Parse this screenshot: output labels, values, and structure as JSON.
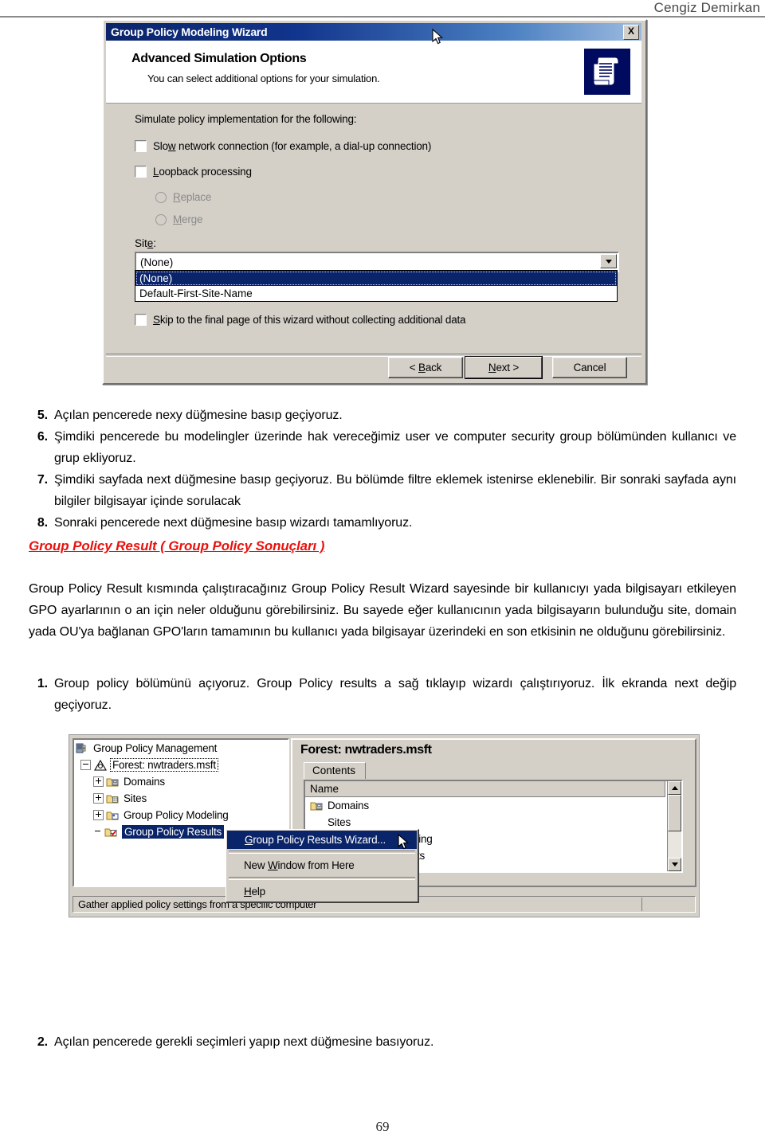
{
  "header": {
    "author": "Cengiz Demirkan"
  },
  "wizard_dialog": {
    "title": "Group Policy Modeling Wizard",
    "close_label": "X",
    "banner_title": "Advanced Simulation Options",
    "banner_subtitle": "You can select additional options for your simulation.",
    "banner_icon": "scroll-document-icon",
    "intro_label": "Simulate policy implementation for the following:",
    "checkbox_slow_network": {
      "label_prefix": "Slo",
      "label_accel": "w",
      "label_suffix": " network connection (for example, a dial-up connection)",
      "checked": false
    },
    "checkbox_loopback": {
      "label_accel": "L",
      "label_suffix": "oopback processing",
      "checked": false
    },
    "radio_replace": {
      "label_accel": "R",
      "label_suffix": "eplace",
      "selected": false,
      "enabled": false
    },
    "radio_merge": {
      "label_accel": "M",
      "label_suffix": "erge",
      "selected": false,
      "enabled": false
    },
    "site_label_prefix": "Sit",
    "site_label_accel": "e",
    "site_label_suffix": ":",
    "site_value": "(None)",
    "site_options": [
      "(None)",
      "Default-First-Site-Name"
    ],
    "site_selected_index": 0,
    "checkbox_skip": {
      "label_accel": "S",
      "label_suffix": "kip to the final page of this wizard without collecting additional data",
      "checked": false
    },
    "buttons": {
      "back_prefix": "< ",
      "back_accel": "B",
      "back_suffix": "ack",
      "next_accel": "N",
      "next_suffix": "ext >",
      "cancel": "Cancel"
    }
  },
  "steps_first": [
    {
      "num": "5.",
      "text": "Açılan pencerede nexy düğmesine basıp geçiyoruz."
    },
    {
      "num": "6.",
      "text": "Şimdiki pencerede bu modelingler üzerinde hak vereceğimiz user ve computer security group bölümünden kullanıcı ve grup ekliyoruz."
    },
    {
      "num": "7.",
      "text": "Şimdiki sayfada next düğmesine basıp geçiyoruz. Bu bölümde filtre eklemek istenirse eklenebilir. Bir sonraki sayfada aynı bilgiler  bilgisayar içinde sorulacak"
    },
    {
      "num": "8.",
      "text": "Sonraki pencerede next düğmesine basıp wizardı tamamlıyoruz."
    }
  ],
  "section": {
    "heading": "Group Policy Result  ( Group Policy Sonuçları )",
    "paragraph": "Group Policy Result kısmında çalıştıracağınız Group Policy Result Wizard sayesinde bir kullanıcıyı yada bilgisayarı etkileyen GPO ayarlarının o an için neler olduğunu görebilirsiniz. Bu sayede eğer kullanıcının yada bilgisayarın bulunduğu site, domain yada OU'ya bağlanan GPO'ların tamamının bu kullanıcı yada bilgisayar üzerindeki en son etkisinin ne olduğunu görebilirsiniz."
  },
  "steps_second": [
    {
      "num": "1.",
      "text": "Group policy bölümünü açıyoruz. Group Policy results a sağ tıklayıp wizardı çalıştırıyoruz. İlk ekranda next değip geçiyoruz."
    }
  ],
  "steps_third": [
    {
      "num": "2.",
      "text": "Açılan pencerede gerekli seçimleri yapıp next düğmesine basıyoruz."
    }
  ],
  "gpmc": {
    "tree": [
      {
        "label": "Group Policy Management",
        "icon": "console-root-icon",
        "expander": "none",
        "state": "normal",
        "indent": 2
      },
      {
        "label": "Forest: nwtraders.msft",
        "icon": "forest-icon",
        "expander": "minus",
        "state": "focused",
        "indent": 12
      },
      {
        "label": "Domains",
        "icon": "domains-folder-icon",
        "expander": "plus",
        "state": "normal",
        "indent": 28
      },
      {
        "label": "Sites",
        "icon": "sites-folder-icon",
        "expander": "plus",
        "state": "normal",
        "indent": 28
      },
      {
        "label": "Group Policy Modeling",
        "icon": "modeling-folder-icon",
        "expander": "plus",
        "state": "normal",
        "indent": 28
      },
      {
        "label": "Group Policy Results",
        "icon": "results-folder-icon",
        "expander": "none",
        "state": "selected",
        "indent": 28
      }
    ],
    "right_pane": {
      "forest_title": "Forest: nwtraders.msft",
      "tab_label": "Contents",
      "column_header": "Name",
      "rows": [
        {
          "label": "Domains",
          "icon": "domains-folder-icon"
        },
        {
          "label": "Sites",
          "icon": "sites-folder-icon"
        },
        {
          "label": "Group Policy Modeling",
          "icon": "modeling-folder-icon"
        },
        {
          "label": "Group Policy Results",
          "icon": "results-folder-icon"
        }
      ],
      "scroll_up": "scroll-up-arrow-icon",
      "scroll_down": "scroll-down-arrow-icon"
    },
    "context_menu": [
      {
        "accel": "G",
        "rest": "roup Policy Results Wizard...",
        "highlighted": true
      },
      {
        "sep": true
      },
      {
        "accel_pre": "New ",
        "accel": "W",
        "rest": "indow from Here",
        "highlighted": false
      },
      {
        "sep": true
      },
      {
        "accel": "H",
        "rest": "elp",
        "highlighted": false
      }
    ],
    "status_text": "Gather applied policy settings from a specific computer"
  },
  "page_number": "69"
}
